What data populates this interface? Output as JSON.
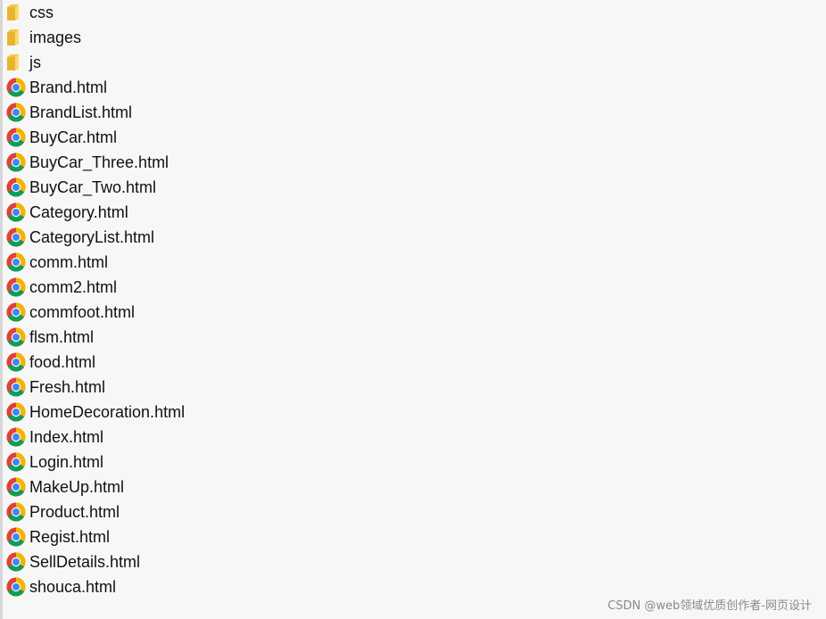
{
  "file_list": {
    "folders": [
      {
        "name": "css",
        "icon": "folder-icon"
      },
      {
        "name": "images",
        "icon": "folder-icon"
      },
      {
        "name": "js",
        "icon": "folder-icon"
      }
    ],
    "files": [
      {
        "name": "Brand.html",
        "icon": "chrome-icon"
      },
      {
        "name": "BrandList.html",
        "icon": "chrome-icon"
      },
      {
        "name": "BuyCar.html",
        "icon": "chrome-icon"
      },
      {
        "name": "BuyCar_Three.html",
        "icon": "chrome-icon"
      },
      {
        "name": "BuyCar_Two.html",
        "icon": "chrome-icon"
      },
      {
        "name": "Category.html",
        "icon": "chrome-icon"
      },
      {
        "name": "CategoryList.html",
        "icon": "chrome-icon"
      },
      {
        "name": "comm.html",
        "icon": "chrome-icon"
      },
      {
        "name": "comm2.html",
        "icon": "chrome-icon"
      },
      {
        "name": "commfoot.html",
        "icon": "chrome-icon"
      },
      {
        "name": "flsm.html",
        "icon": "chrome-icon"
      },
      {
        "name": "food.html",
        "icon": "chrome-icon"
      },
      {
        "name": "Fresh.html",
        "icon": "chrome-icon"
      },
      {
        "name": "HomeDecoration.html",
        "icon": "chrome-icon"
      },
      {
        "name": "Index.html",
        "icon": "chrome-icon"
      },
      {
        "name": "Login.html",
        "icon": "chrome-icon"
      },
      {
        "name": "MakeUp.html",
        "icon": "chrome-icon"
      },
      {
        "name": "Product.html",
        "icon": "chrome-icon"
      },
      {
        "name": "Regist.html",
        "icon": "chrome-icon"
      },
      {
        "name": "SellDetails.html",
        "icon": "chrome-icon"
      },
      {
        "name": "shouca.html",
        "icon": "chrome-icon"
      }
    ]
  },
  "watermark": {
    "text": "CSDN @web领域优质创作者-网页设计"
  },
  "colors": {
    "background": "#f7f7f7",
    "text": "#111111",
    "folder_yellow": "#f5c542",
    "chrome_red": "#db4437",
    "chrome_yellow": "#f4b400",
    "chrome_green": "#0f9d58",
    "chrome_blue": "#4285f4"
  }
}
